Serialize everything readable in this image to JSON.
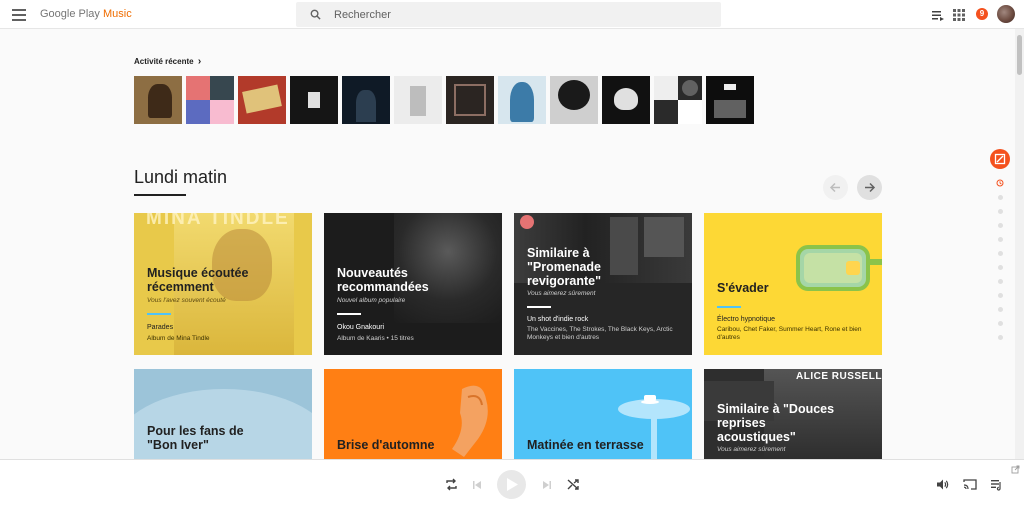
{
  "header": {
    "logo_google": "Google Play",
    "logo_music": "Music",
    "search_placeholder": "Rechercher",
    "notification_count": "9"
  },
  "recent": {
    "title": "Activité récente",
    "chevron": "›",
    "thumbs": [
      {
        "name": "album-1",
        "color": "#8d6e43"
      },
      {
        "name": "album-2",
        "color": "#3d4c6b"
      },
      {
        "name": "album-3",
        "color": "#b23a2a"
      },
      {
        "name": "album-4",
        "color": "#1a1a1a"
      },
      {
        "name": "album-5",
        "color": "#0f1a26"
      },
      {
        "name": "album-6",
        "color": "#e9e9e9"
      },
      {
        "name": "album-7",
        "color": "#2b2522"
      },
      {
        "name": "album-8",
        "color": "#4f8fb5"
      },
      {
        "name": "album-9",
        "color": "#cfcfcf"
      },
      {
        "name": "album-10",
        "color": "#111111"
      },
      {
        "name": "album-11",
        "color": "#2a2a2a"
      },
      {
        "name": "album-12",
        "color": "#0d0d0d"
      }
    ]
  },
  "section": {
    "title": "Lundi matin"
  },
  "cards": [
    {
      "title": "Musique écoutée\nrécemment",
      "subtitle": "Vous l'avez souvent écouté",
      "meta_title": "Parades",
      "meta_sub": "Album de Mina Tindle",
      "overlay_text": "MINA TINDLE",
      "bg": "#e8c94a",
      "accent": "#4fc3f7"
    },
    {
      "title": "Nouveautés\nrecommandées",
      "subtitle": "Nouvel album populaire",
      "meta_title": "Okou Gnakouri",
      "meta_sub": "Album de Kaaris • 15 titres",
      "bg": "#1c1c1c",
      "accent": "#ffffff"
    },
    {
      "title": "Similaire à\n\"Promenade\nrevigorante\"",
      "subtitle": "Vous aimerez sûrement",
      "meta_title": "Un shot d'indie rock",
      "meta_sub": "The Vaccines, The Strokes, The Black Keys, Arctic Monkeys et bien d'autres",
      "bg": "#262626",
      "accent": "#ffffff"
    },
    {
      "title": "S'évader",
      "subtitle": "",
      "meta_title": "Électro hypnotique",
      "meta_sub": "Caribou, Chet Faker, Summer Heart, Rone et bien d'autres",
      "bg": "#fdd835",
      "accent": "#4fc3f7"
    },
    {
      "title": "Pour les fans de\n\"Bon Iver\"",
      "subtitle": "",
      "meta_title": "",
      "meta_sub": "",
      "bg": "#9cc4d9",
      "accent": "#ffffff"
    },
    {
      "title": "Brise d'automne",
      "subtitle": "",
      "meta_title": "",
      "meta_sub": "",
      "bg": "#ff7f14",
      "accent": "#ffffff"
    },
    {
      "title": "Matinée en terrasse",
      "subtitle": "",
      "meta_title": "",
      "meta_sub": "",
      "bg": "#29b6f6",
      "accent": "#ffffff"
    },
    {
      "title": "Similaire à \"Douces\nreprises\nacoustiques\"",
      "subtitle": "Vous aimerez sûrement",
      "meta_title": "",
      "meta_sub": "",
      "overlay_text": "ALICE RUSSELL",
      "bg": "#2e2e2e",
      "accent": "#ffffff"
    }
  ],
  "colors": {
    "brand": "#ef6c00",
    "badge": "#f4511e"
  }
}
